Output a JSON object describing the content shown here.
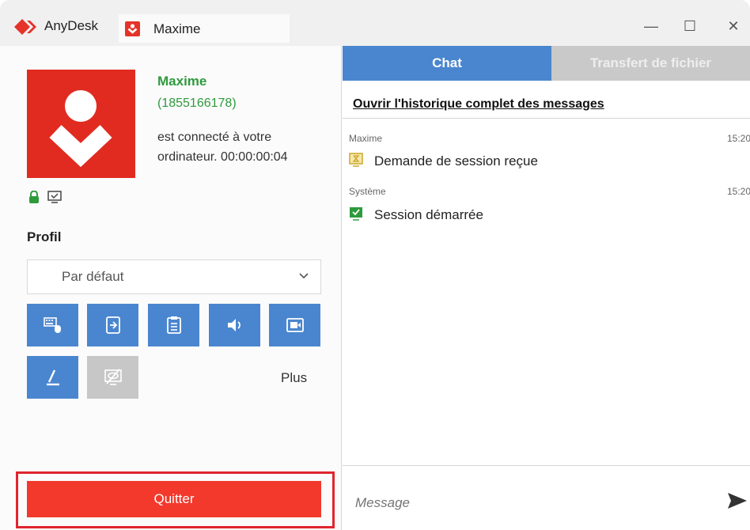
{
  "titlebar": {
    "app_name": "AnyDesk",
    "tab_label": "Maxime",
    "minimize_label": "—",
    "maximize_label": "☐",
    "close_label": "✕"
  },
  "session": {
    "name": "Maxime",
    "id": "(1855166178)",
    "status": "est connecté à votre ordinateur. 00:00:00:04"
  },
  "profile": {
    "heading": "Profil",
    "selected": "Par défaut"
  },
  "actions": {
    "more_label": "Plus",
    "items": [
      "keyboard-mouse",
      "file-transfer",
      "clipboard",
      "audio",
      "screen-recording",
      "draw",
      "privacy-mode"
    ]
  },
  "quit_label": "Quitter",
  "tabs": {
    "chat": "Chat",
    "file_transfer": "Transfert de fichier"
  },
  "chat": {
    "history_link": "Ouvrir l'historique complet des messages",
    "messages": [
      {
        "sender": "Maxime",
        "time": "15:20",
        "text": "Demande de session reçue"
      },
      {
        "sender": "Système",
        "time": "15:20",
        "text": "Session démarrée"
      }
    ],
    "input_placeholder": "Message"
  },
  "colors": {
    "accent_blue": "#4a86cf",
    "brand_red": "#e12b20",
    "quit_red": "#f2392c",
    "connected_green": "#2e9a3c"
  }
}
